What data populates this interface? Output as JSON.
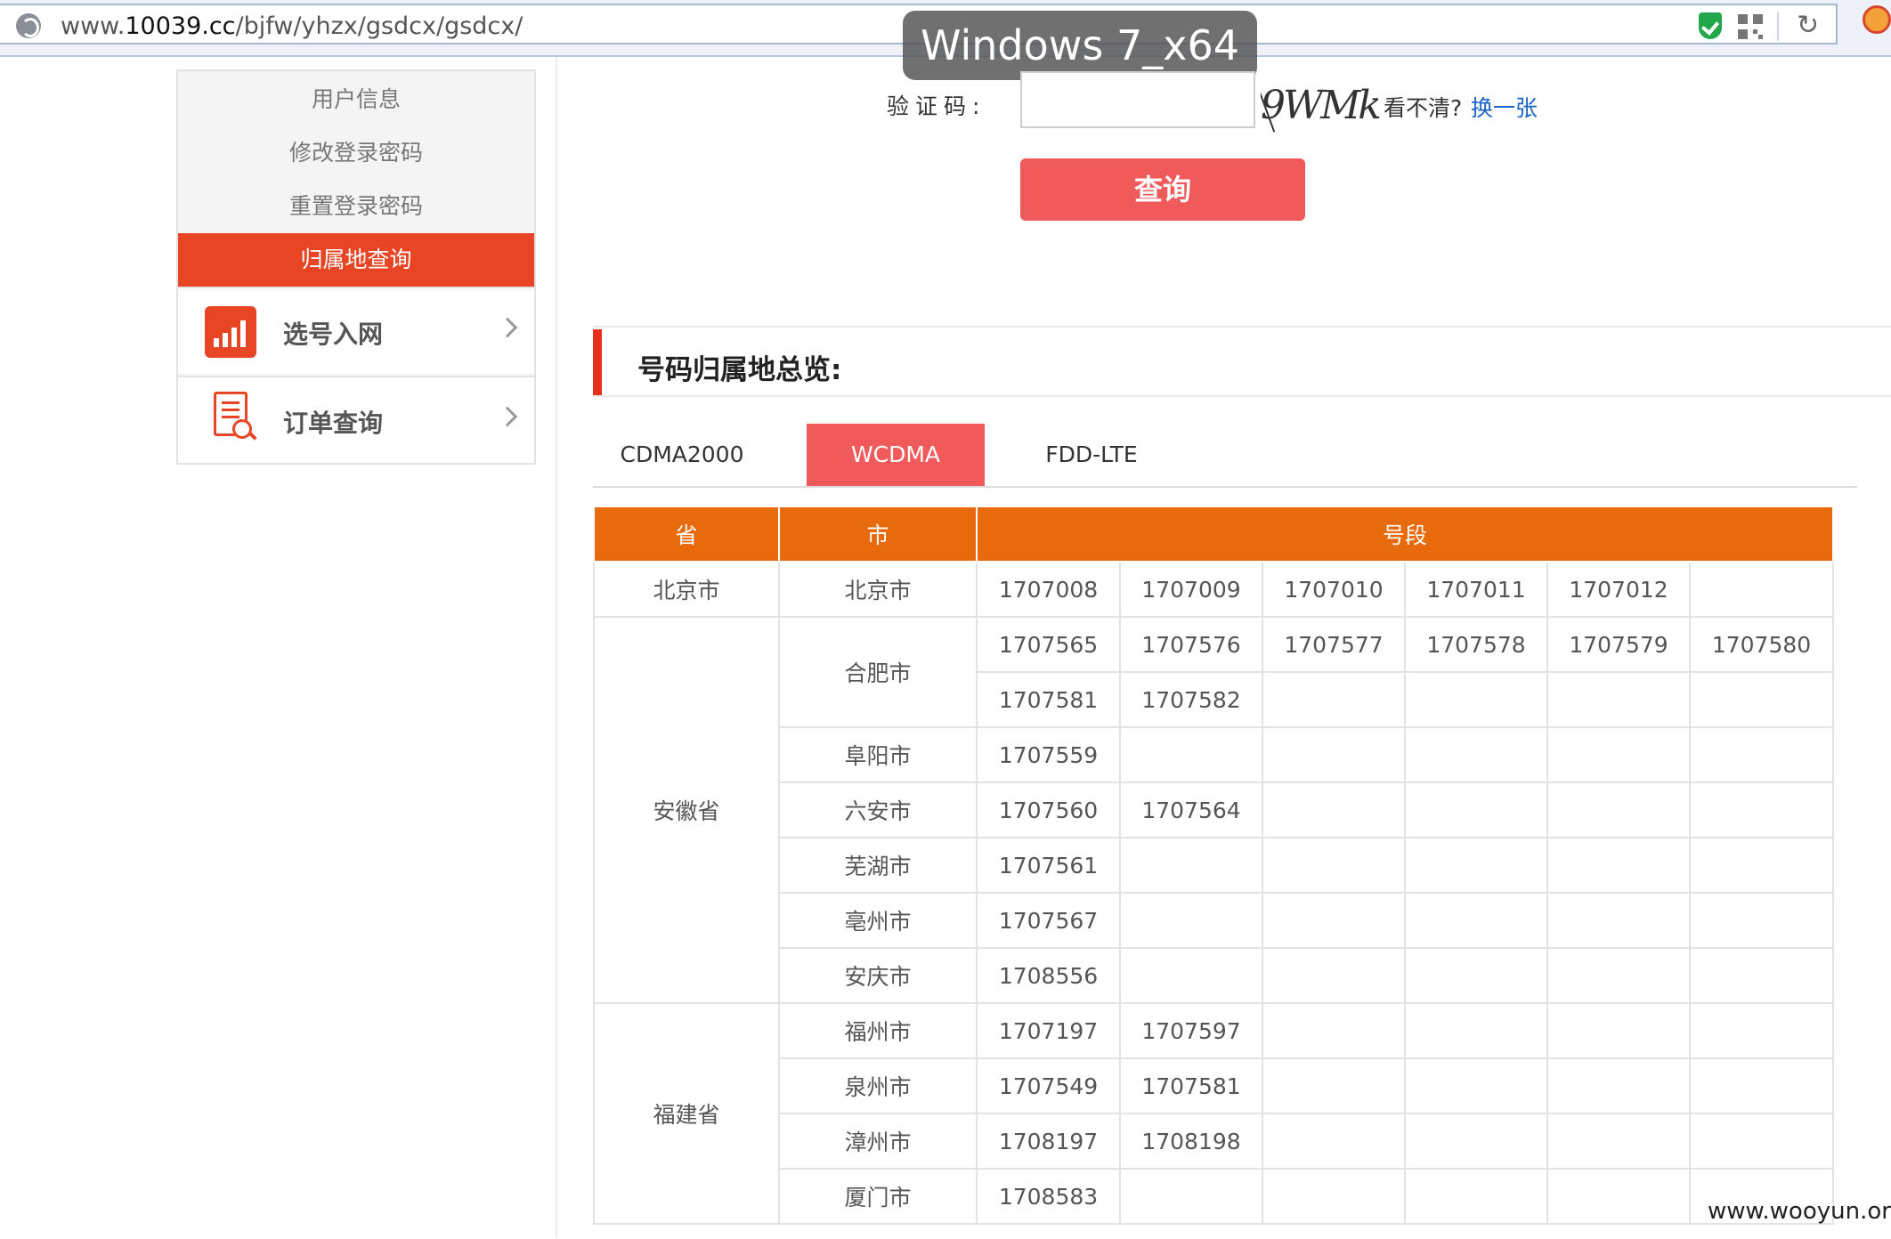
{
  "browser": {
    "url_prefix": "www.",
    "url_domain": "10039.cc",
    "url_path": "/bjfw/yhzx/gsdcx/gsdcx/",
    "os_badge": "Windows 7_x64",
    "reload_glyph": "↻"
  },
  "sidebar": {
    "sub_items": [
      "用户信息",
      "修改登录密码",
      "重置登录密码",
      "归属地查询"
    ],
    "active_sub_index": 3,
    "main_items": [
      {
        "label": "选号入网",
        "icon": "signal-bars-icon"
      },
      {
        "label": "订单查询",
        "icon": "document-search-icon"
      }
    ]
  },
  "form": {
    "captcha_label": "验证码:",
    "captcha_image_text": "9WMk",
    "captcha_hint": "看不清?",
    "captcha_refresh": "换一张",
    "query_button": "查询"
  },
  "overview": {
    "title": "号码归属地总览:"
  },
  "tabs": [
    {
      "label": "CDMA2000",
      "active": false
    },
    {
      "label": "WCDMA",
      "active": true
    },
    {
      "label": "FDD-LTE",
      "active": false
    }
  ],
  "table": {
    "headers": {
      "province": "省",
      "city": "市",
      "segment": "号段"
    },
    "provinces": [
      {
        "name": "北京市",
        "cities": [
          {
            "name": "北京市",
            "rows": [
              [
                "1707008",
                "1707009",
                "1707010",
                "1707011",
                "1707012",
                ""
              ]
            ]
          }
        ]
      },
      {
        "name": "安徽省",
        "cities": [
          {
            "name": "合肥市",
            "rows": [
              [
                "1707565",
                "1707576",
                "1707577",
                "1707578",
                "1707579",
                "1707580"
              ],
              [
                "1707581",
                "1707582",
                "",
                "",
                "",
                ""
              ]
            ]
          },
          {
            "name": "阜阳市",
            "rows": [
              [
                "1707559",
                "",
                "",
                "",
                "",
                ""
              ]
            ]
          },
          {
            "name": "六安市",
            "rows": [
              [
                "1707560",
                "1707564",
                "",
                "",
                "",
                ""
              ]
            ]
          },
          {
            "name": "芜湖市",
            "rows": [
              [
                "1707561",
                "",
                "",
                "",
                "",
                ""
              ]
            ]
          },
          {
            "name": "亳州市",
            "rows": [
              [
                "1707567",
                "",
                "",
                "",
                "",
                ""
              ]
            ]
          },
          {
            "name": "安庆市",
            "rows": [
              [
                "1708556",
                "",
                "",
                "",
                "",
                ""
              ]
            ]
          }
        ]
      },
      {
        "name": "福建省",
        "cities": [
          {
            "name": "福州市",
            "rows": [
              [
                "1707197",
                "1707597",
                "",
                "",
                "",
                ""
              ]
            ]
          },
          {
            "name": "泉州市",
            "rows": [
              [
                "1707549",
                "1707581",
                "",
                "",
                "",
                ""
              ]
            ]
          },
          {
            "name": "漳州市",
            "rows": [
              [
                "1708197",
                "1708198",
                "",
                "",
                "",
                ""
              ]
            ]
          },
          {
            "name": "厦门市",
            "rows": [
              [
                "1708583",
                "",
                "",
                "",
                "",
                ""
              ]
            ]
          }
        ]
      }
    ]
  },
  "watermark": "www.wooyun.org"
}
